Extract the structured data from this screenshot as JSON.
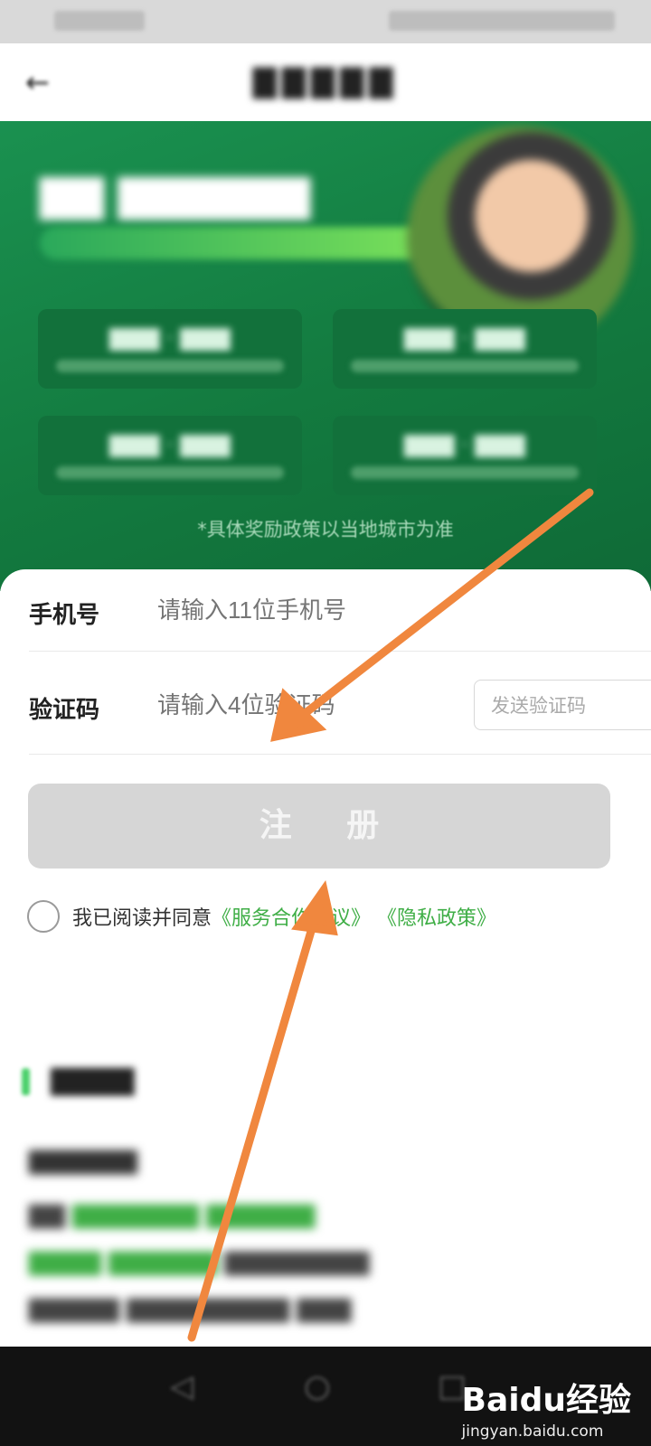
{
  "banner": {
    "accent": "#1a9150",
    "note": "*具体奖励政策以当地城市为准"
  },
  "form": {
    "phone_label": "手机号",
    "phone_placeholder": "请输入11位手机号",
    "code_label": "验证码",
    "code_placeholder": "请输入4位验证码",
    "send_code": "发送验证码",
    "register": "注 册",
    "agree_text": "我已阅读并同意",
    "service_link": "《服务合作协议》",
    "privacy_link": "《隐私政策》",
    "link_color": "#3fae46"
  },
  "annotation": {
    "arrow_color": "#f0873e",
    "arrow_count": 2
  },
  "bottom_nav": {
    "icons": [
      "back-triangle-icon",
      "home-circle-icon",
      "recent-apps-icon"
    ]
  },
  "watermark": {
    "brand": "Baidu经验",
    "url": "jingyan.baidu.com"
  }
}
